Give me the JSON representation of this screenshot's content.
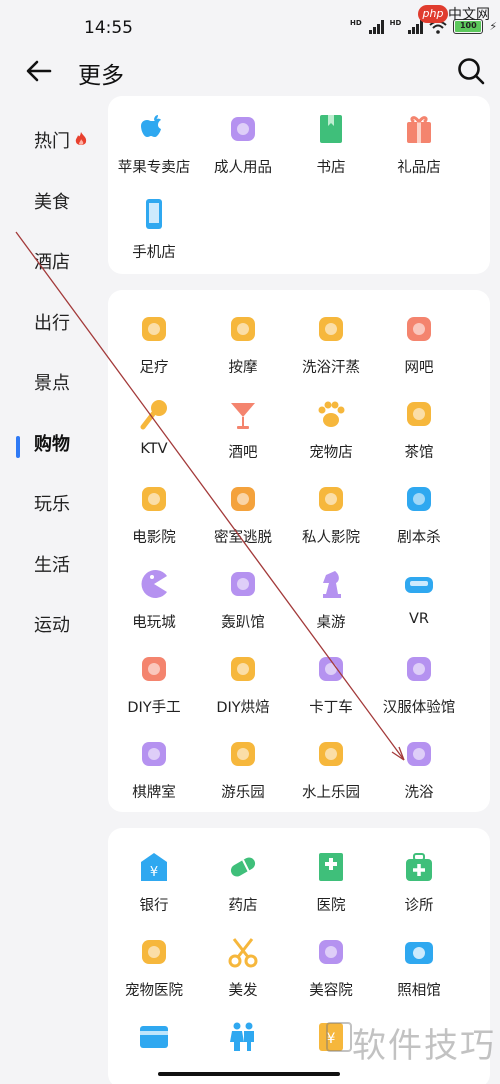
{
  "status": {
    "time": "14:55",
    "battery": "100",
    "watermark_top_badge": "php",
    "watermark_top_text": "中文网"
  },
  "header": {
    "title": "更多"
  },
  "sidebar": {
    "items": [
      {
        "label": "热门",
        "icon": "fire-icon",
        "active": false
      },
      {
        "label": "美食",
        "active": false
      },
      {
        "label": "酒店",
        "active": false
      },
      {
        "label": "出行",
        "active": false
      },
      {
        "label": "景点",
        "active": false
      },
      {
        "label": "购物",
        "active": true
      },
      {
        "label": "玩乐",
        "active": false
      },
      {
        "label": "生活",
        "active": false
      },
      {
        "label": "运动",
        "active": false
      }
    ],
    "active_color": "#2f7af5"
  },
  "shopping_card": {
    "items": [
      {
        "label": "苹果专卖店",
        "icon": "apple-icon",
        "color": "#2fa8f0"
      },
      {
        "label": "成人用品",
        "icon": "gender-symbols-icon",
        "color": "#b592f0"
      },
      {
        "label": "书店",
        "icon": "book-icon",
        "color": "#3fbf7a"
      },
      {
        "label": "礼品店",
        "icon": "gift-icon",
        "color": "#f4846e"
      },
      {
        "label": "手机店",
        "icon": "phone-icon",
        "color": "#2fa8f0"
      }
    ]
  },
  "fun_card": {
    "items": [
      {
        "label": "足疗",
        "icon": "foot-icon",
        "color": "#f6b73c"
      },
      {
        "label": "按摩",
        "icon": "massage-icon",
        "color": "#f6b73c"
      },
      {
        "label": "洗浴汗蒸",
        "icon": "steam-icon",
        "color": "#f6b73c"
      },
      {
        "label": "网吧",
        "icon": "wifi-monitor-icon",
        "color": "#f4846e"
      },
      {
        "label": "KTV",
        "icon": "microphone-icon",
        "color": "#f6b73c"
      },
      {
        "label": "酒吧",
        "icon": "cocktail-icon",
        "color": "#f4846e"
      },
      {
        "label": "宠物店",
        "icon": "paw-icon",
        "color": "#f6b73c"
      },
      {
        "label": "茶馆",
        "icon": "tea-bowl-icon",
        "color": "#f6b73c"
      },
      {
        "label": "电影院",
        "icon": "film-icon",
        "color": "#f6b73c"
      },
      {
        "label": "密室逃脱",
        "icon": "key-icon",
        "color": "#f4a23c"
      },
      {
        "label": "私人影院",
        "icon": "film-reel-icon",
        "color": "#f6b73c"
      },
      {
        "label": "剧本杀",
        "icon": "head-silhouette-icon",
        "color": "#2fa8f0"
      },
      {
        "label": "电玩城",
        "icon": "pacman-icon",
        "color": "#b592f0"
      },
      {
        "label": "轰趴馆",
        "icon": "mask-icon",
        "color": "#b592f0"
      },
      {
        "label": "桌游",
        "icon": "chess-knight-icon",
        "color": "#b592f0"
      },
      {
        "label": "VR",
        "icon": "vr-goggles-icon",
        "color": "#2fa8f0"
      },
      {
        "label": "DIY手工",
        "icon": "vase-icon",
        "color": "#f4846e"
      },
      {
        "label": "DIY烘焙",
        "icon": "chef-hat-icon",
        "color": "#f6b73c"
      },
      {
        "label": "卡丁车",
        "icon": "go-kart-icon",
        "color": "#b592f0"
      },
      {
        "label": "汉服体验馆",
        "icon": "hanfu-icon",
        "color": "#b592f0"
      },
      {
        "label": "棋牌室",
        "icon": "cards-icon",
        "color": "#b592f0"
      },
      {
        "label": "游乐园",
        "icon": "ferris-wheel-icon",
        "color": "#f6b73c"
      },
      {
        "label": "水上乐园",
        "icon": "water-slide-icon",
        "color": "#f6b73c"
      },
      {
        "label": "洗浴",
        "icon": "bath-icon",
        "color": "#b592f0"
      }
    ]
  },
  "life_card": {
    "items": [
      {
        "label": "银行",
        "icon": "bank-icon",
        "color": "#2fa8f0"
      },
      {
        "label": "药店",
        "icon": "pill-icon",
        "color": "#3fbf7a"
      },
      {
        "label": "医院",
        "icon": "hospital-icon",
        "color": "#3fbf7a"
      },
      {
        "label": "诊所",
        "icon": "medical-kit-icon",
        "color": "#3fbf7a"
      },
      {
        "label": "宠物医院",
        "icon": "pet-hospital-icon",
        "color": "#f6b73c"
      },
      {
        "label": "美发",
        "icon": "scissors-icon",
        "color": "#f6b73c"
      },
      {
        "label": "美容院",
        "icon": "face-mask-icon",
        "color": "#b592f0"
      },
      {
        "label": "照相馆",
        "icon": "camera-icon",
        "color": "#2fa8f0"
      },
      {
        "label": "",
        "icon": "card-icon",
        "color": "#2fa8f0"
      },
      {
        "label": "",
        "icon": "restroom-icon",
        "color": "#2fa8f0"
      },
      {
        "label": "",
        "icon": "yuan-icon",
        "color": "#f6b73c"
      }
    ]
  },
  "watermark_bottom": "软件技巧"
}
